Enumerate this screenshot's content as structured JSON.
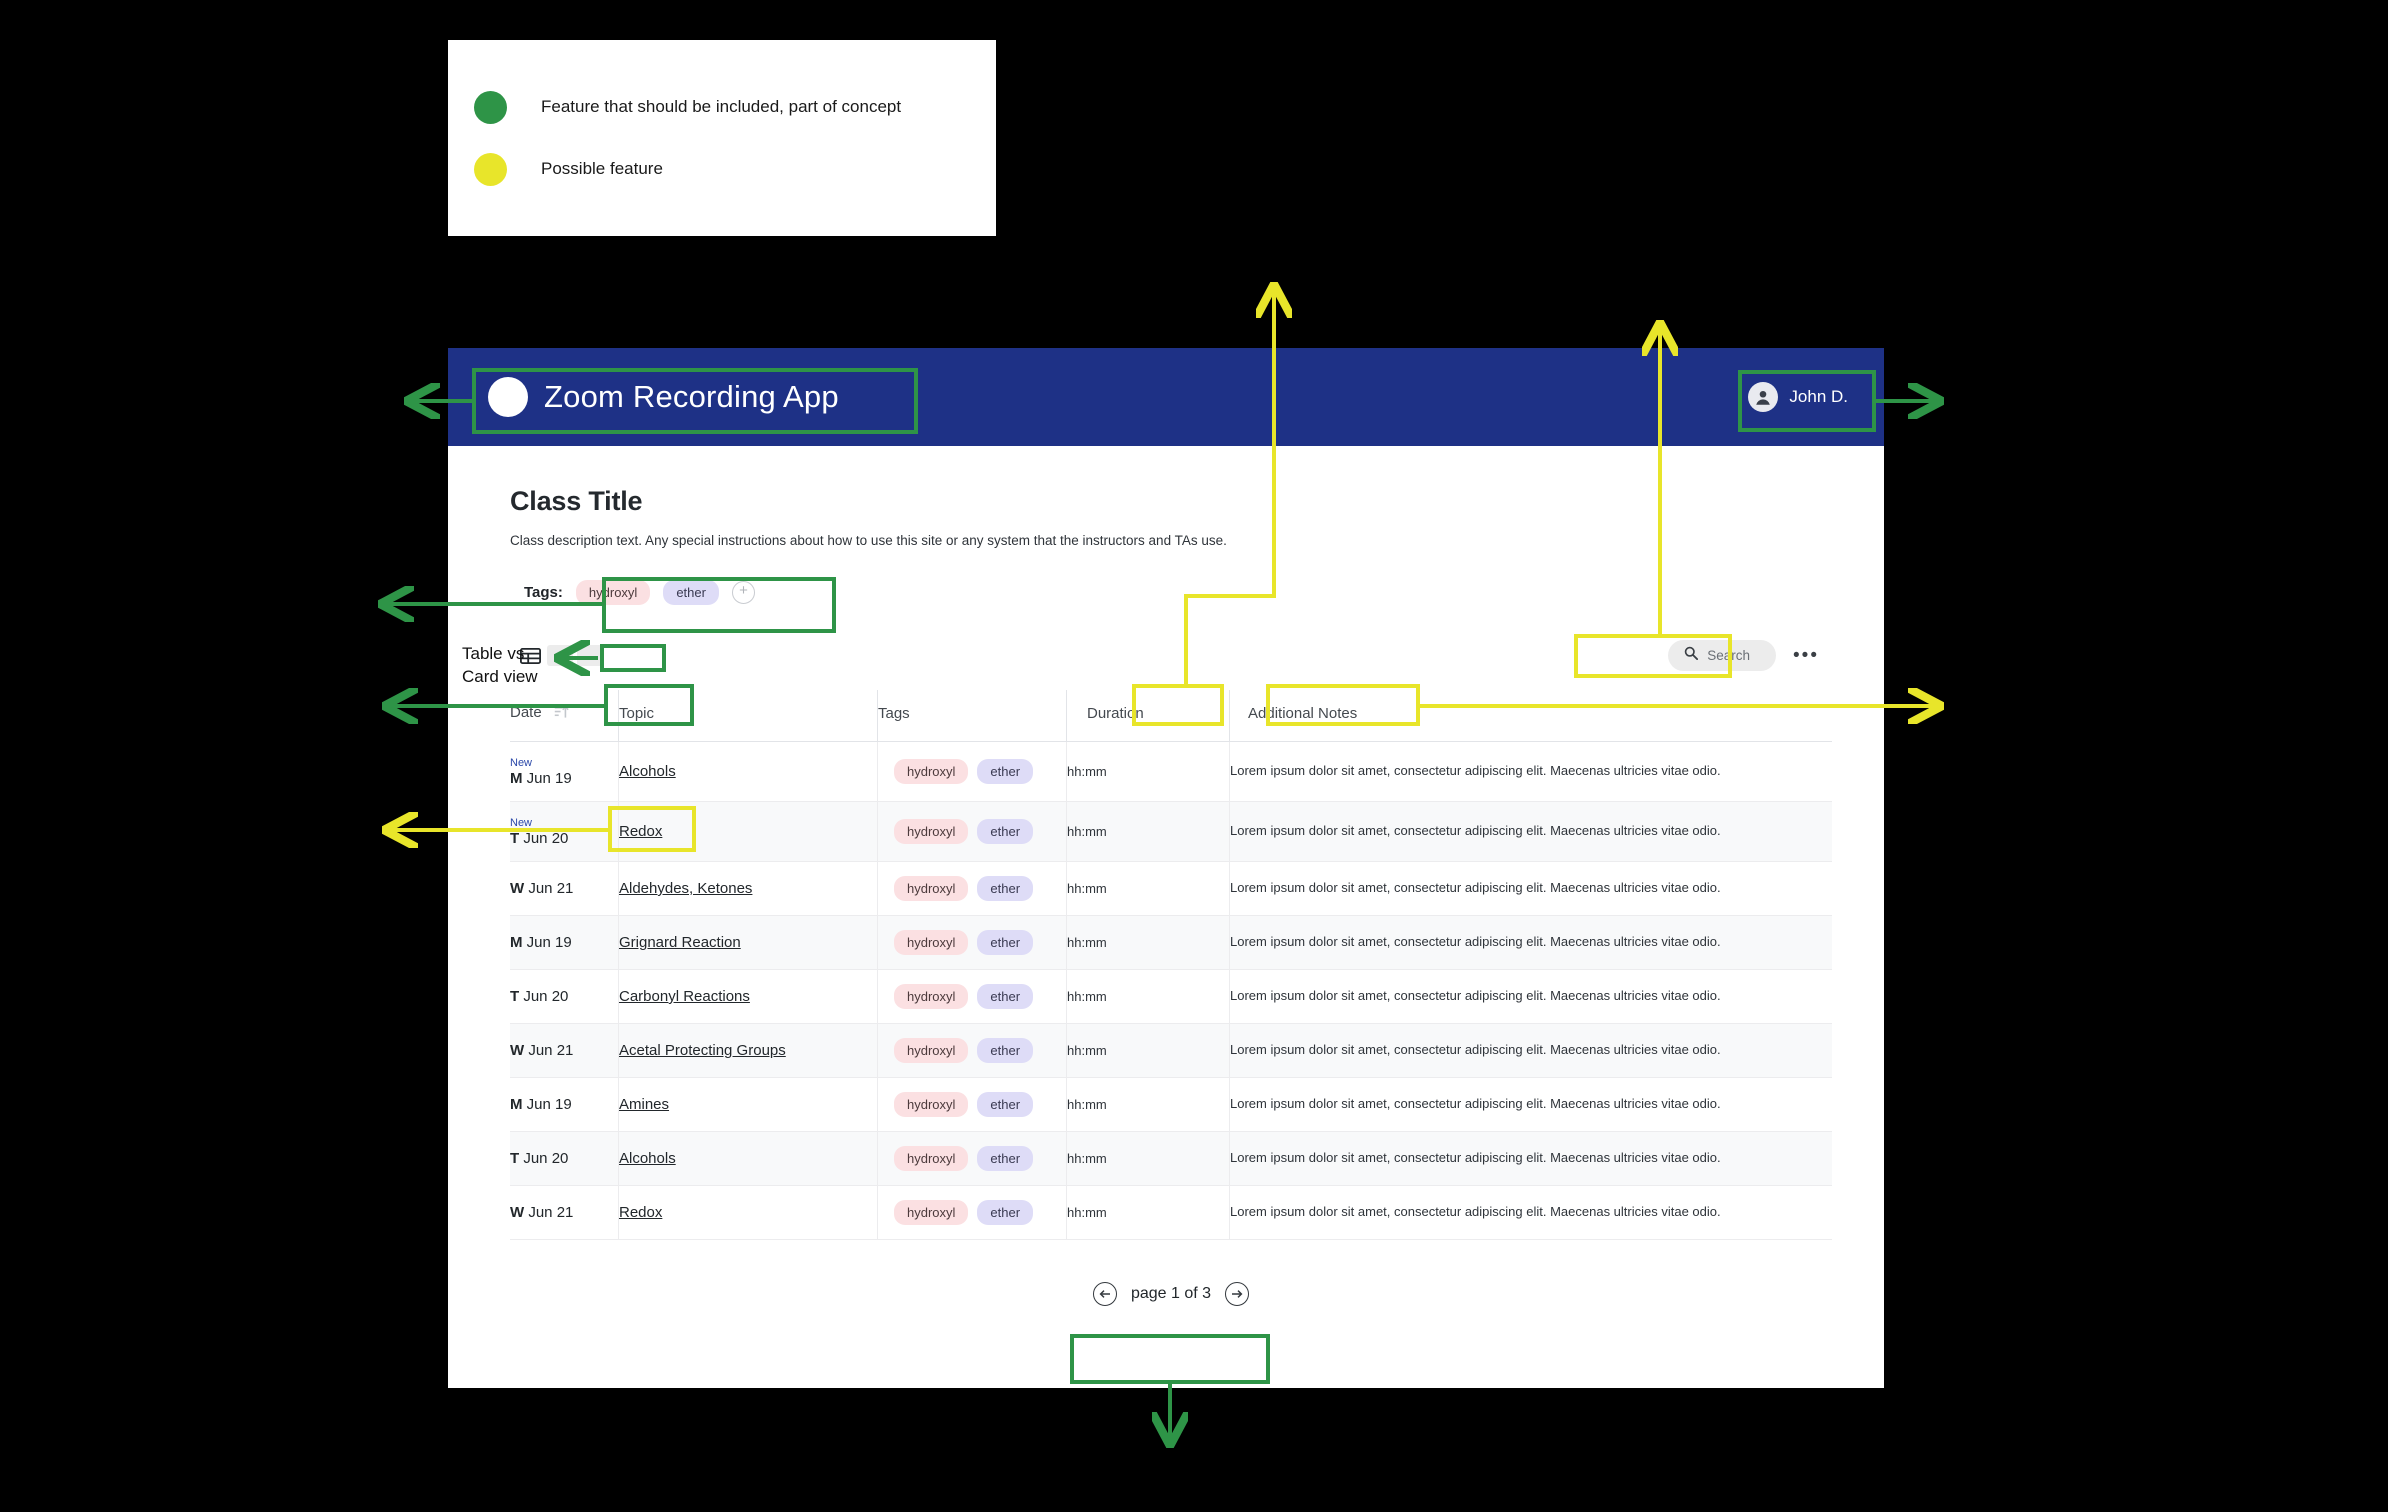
{
  "legend": {
    "items": [
      {
        "label": "Feature that should be included, part of concept",
        "color": "#2e9447",
        "dot": "green-dot-icon"
      },
      {
        "label": "Possible feature",
        "color": "#e8e52a",
        "dot": "yellow-dot-icon"
      }
    ]
  },
  "annotations": {
    "table_vs_card_label": "Table vs\nCard view",
    "table_vs_card_line1": "Table vs",
    "table_vs_card_line2": "Card view",
    "green_color": "#2e9447",
    "yellow_color": "#e8e52a"
  },
  "app": {
    "header": {
      "brand_title": "Zoom Recording App",
      "logo_icon": "circle-logo-icon",
      "user_name": "John D.",
      "user_avatar_icon": "user-avatar-icon",
      "background_color": "#1E3186"
    },
    "page": {
      "title": "Class Title",
      "description": "Class description text. Any special instructions about how to use this site or any system that the instructors and TAs use."
    },
    "tags_section": {
      "label": "Tags:",
      "tags": [
        {
          "name": "hydroxyl",
          "color": "#fbe0e2"
        },
        {
          "name": "ether",
          "color": "#dedcf7"
        }
      ],
      "add_icon": "plus-icon",
      "add_label": "+"
    },
    "toolbar": {
      "view_toggle": {
        "table_icon": "table-view-icon",
        "card_icon": "card-view-icon",
        "selected": "table"
      },
      "search": {
        "placeholder": "Search",
        "value": "",
        "icon": "search-icon"
      },
      "overflow_icon": "kebab-menu-icon",
      "overflow_label": "•••"
    },
    "table": {
      "columns": [
        {
          "key": "date",
          "label": "Date",
          "sort_icon": "sort-ascending-icon"
        },
        {
          "key": "topic",
          "label": "Topic"
        },
        {
          "key": "tags",
          "label": "Tags"
        },
        {
          "key": "duration",
          "label": "Duration"
        },
        {
          "key": "notes",
          "label": "Additional Notes"
        }
      ],
      "new_badge_label": "New",
      "notes_text": "Lorem ipsum dolor sit amet, consectetur adipiscing elit. Maecenas ultricies vitae odio.",
      "rows": [
        {
          "is_new": true,
          "day": "M",
          "date": "Jun 19",
          "topic": "Alcohols",
          "tags": [
            "hydroxyl",
            "ether"
          ],
          "duration": "hh:mm",
          "notes": "Lorem ipsum dolor sit amet, consectetur adipiscing elit. Maecenas ultricies vitae odio."
        },
        {
          "is_new": true,
          "day": "T",
          "date": "Jun 20",
          "topic": "Redox",
          "tags": [
            "hydroxyl",
            "ether"
          ],
          "duration": "hh:mm",
          "notes": "Lorem ipsum dolor sit amet, consectetur adipiscing elit. Maecenas ultricies vitae odio."
        },
        {
          "is_new": false,
          "day": "W",
          "date": "Jun 21",
          "topic": "Aldehydes, Ketones",
          "tags": [
            "hydroxyl",
            "ether"
          ],
          "duration": "hh:mm",
          "notes": "Lorem ipsum dolor sit amet, consectetur adipiscing elit. Maecenas ultricies vitae odio."
        },
        {
          "is_new": false,
          "day": "M",
          "date": "Jun 19",
          "topic": "Grignard Reaction",
          "tags": [
            "hydroxyl",
            "ether"
          ],
          "duration": "hh:mm",
          "notes": "Lorem ipsum dolor sit amet, consectetur adipiscing elit. Maecenas ultricies vitae odio."
        },
        {
          "is_new": false,
          "day": "T",
          "date": "Jun 20",
          "topic": "Carbonyl Reactions",
          "tags": [
            "hydroxyl",
            "ether"
          ],
          "duration": "hh:mm",
          "notes": "Lorem ipsum dolor sit amet, consectetur adipiscing elit. Maecenas ultricies vitae odio."
        },
        {
          "is_new": false,
          "day": "W",
          "date": "Jun 21",
          "topic": "Acetal Protecting Groups",
          "tags": [
            "hydroxyl",
            "ether"
          ],
          "duration": "hh:mm",
          "notes": "Lorem ipsum dolor sit amet, consectetur adipiscing elit. Maecenas ultricies vitae odio."
        },
        {
          "is_new": false,
          "day": "M",
          "date": "Jun 19",
          "topic": "Amines",
          "tags": [
            "hydroxyl",
            "ether"
          ],
          "duration": "hh:mm",
          "notes": "Lorem ipsum dolor sit amet, consectetur adipiscing elit. Maecenas ultricies vitae odio."
        },
        {
          "is_new": false,
          "day": "T",
          "date": "Jun 20",
          "topic": "Alcohols",
          "tags": [
            "hydroxyl",
            "ether"
          ],
          "duration": "hh:mm",
          "notes": "Lorem ipsum dolor sit amet, consectetur adipiscing elit. Maecenas ultricies vitae odio."
        },
        {
          "is_new": false,
          "day": "W",
          "date": "Jun 21",
          "topic": "Redox",
          "tags": [
            "hydroxyl",
            "ether"
          ],
          "duration": "hh:mm",
          "notes": "Lorem ipsum dolor sit amet, consectetur adipiscing elit. Maecenas ultricies vitae odio."
        }
      ]
    },
    "pagination": {
      "prev_icon": "arrow-left-circle-icon",
      "next_icon": "arrow-right-circle-icon",
      "label": "page 1 of 3"
    }
  }
}
